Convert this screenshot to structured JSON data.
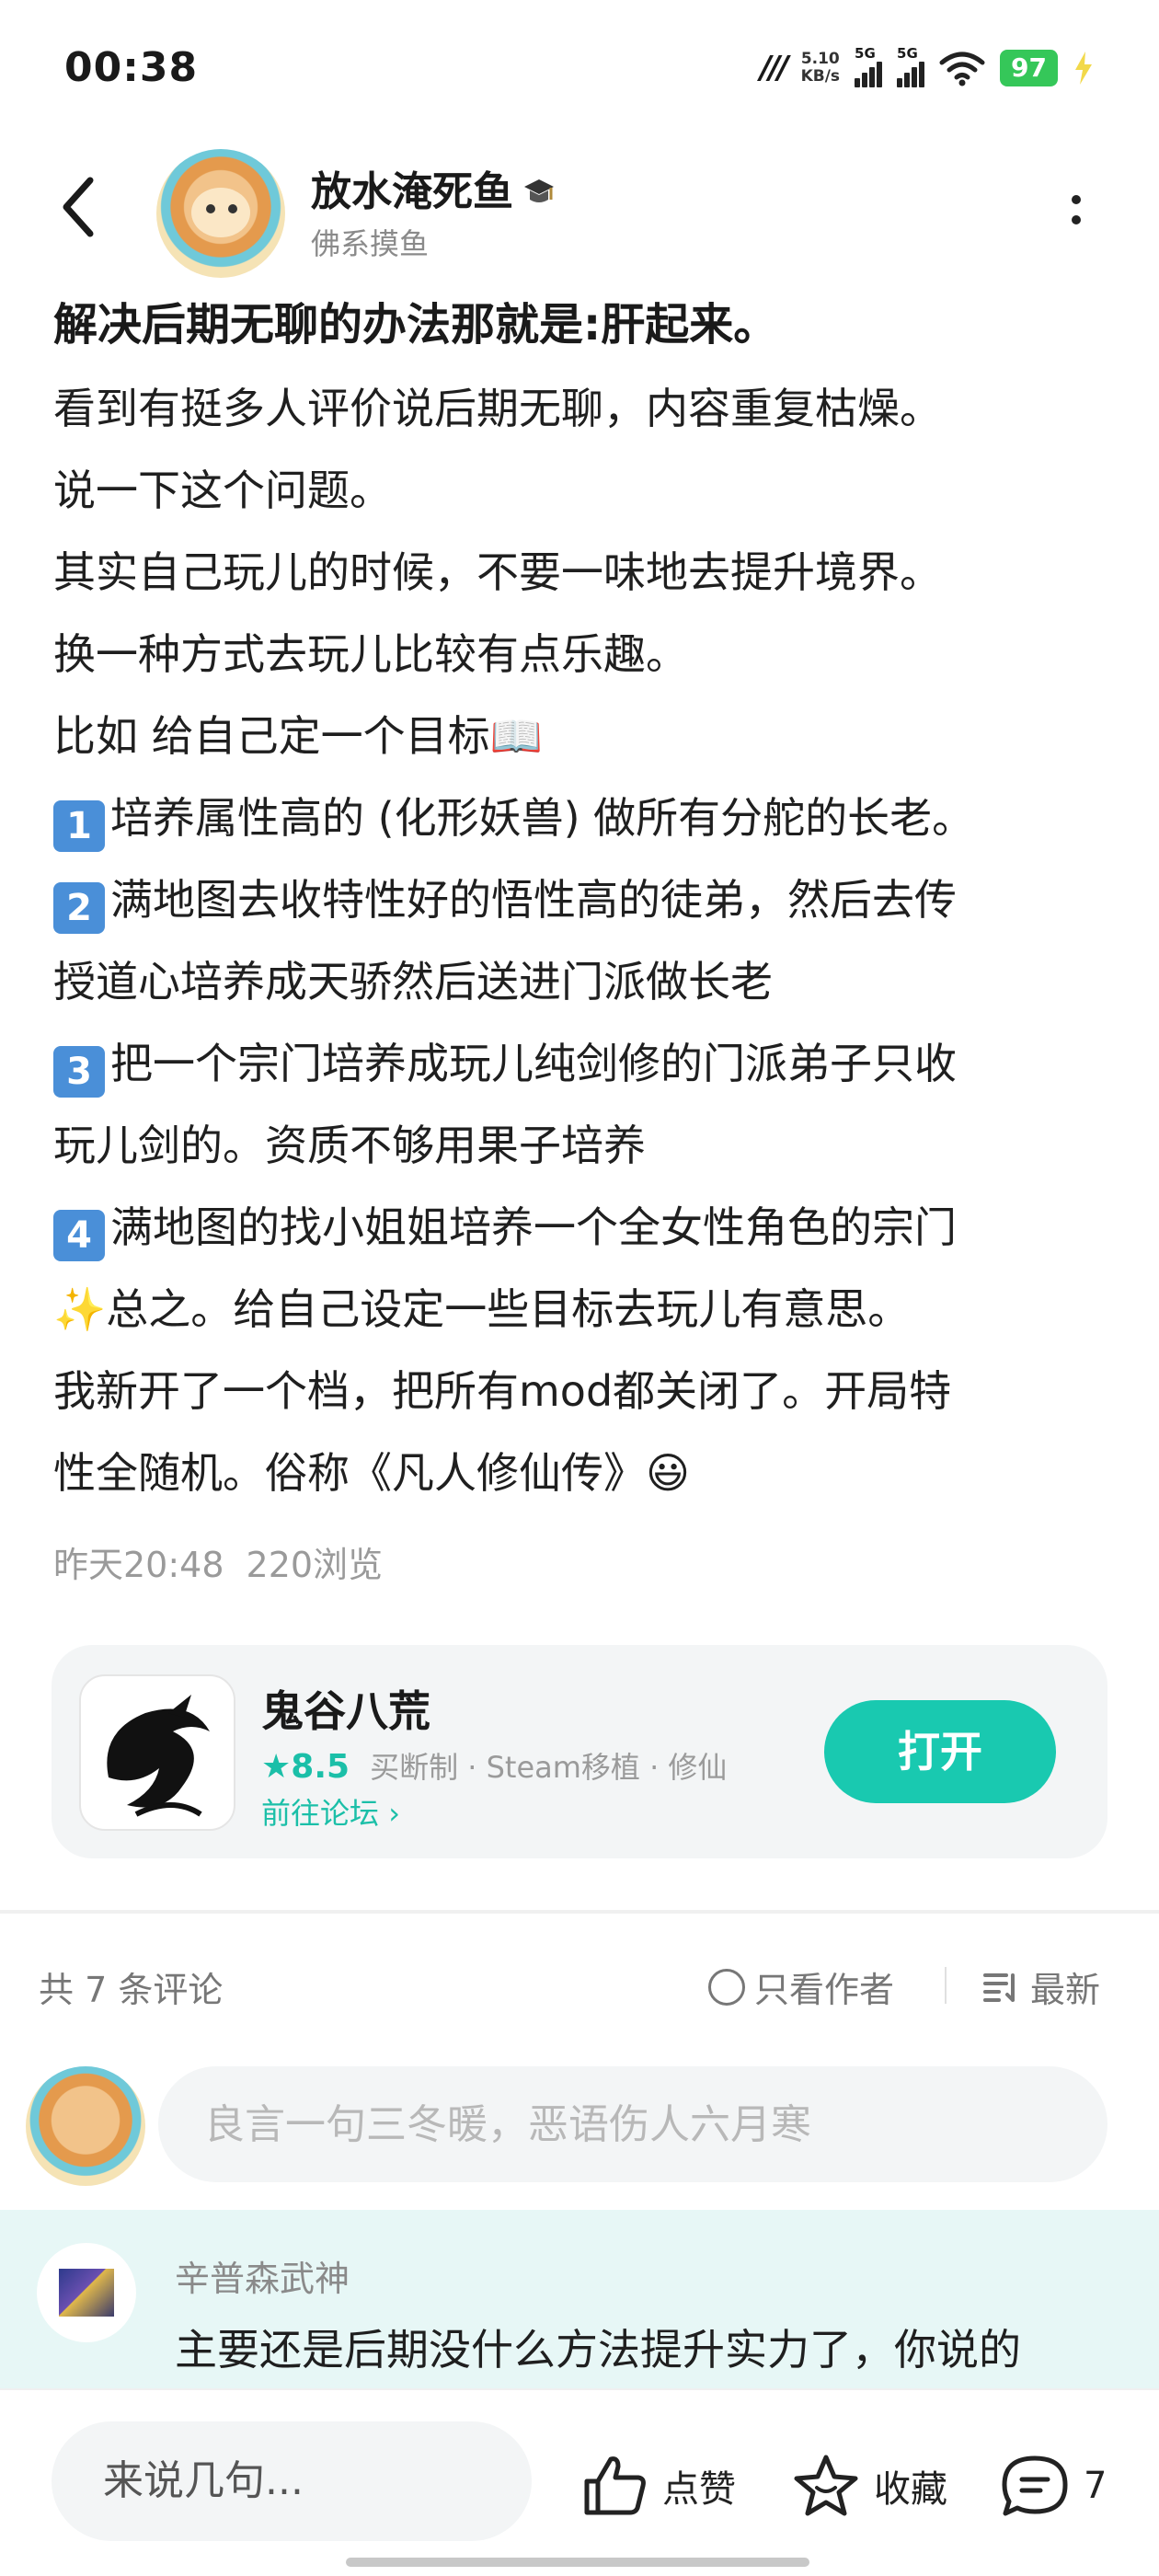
{
  "status_bar": {
    "time": "00:38",
    "net_speed_value": "5.10",
    "net_speed_unit": "KB/s",
    "sim1": "5G",
    "sim2": "5G",
    "battery": "97"
  },
  "author": {
    "name": "放水淹死鱼",
    "subtitle": "佛系摸鱼"
  },
  "post": {
    "title": "解决后期无聊的办法那就是:肝起来。",
    "lines": [
      "看到有挺多人评价说后期无聊，内容重复枯燥。",
      "说一下这个问题。",
      "其实自己玩儿的时候，不要一味地去提升境界。",
      "换一种方式去玩儿比较有点乐趣。",
      "比如 给自己定一个目标📖"
    ],
    "items": [
      {
        "num": "1",
        "text": "培养属性高的 (化形妖兽) 做所有分舵的长老。"
      },
      {
        "num": "2",
        "text": "满地图去收特性好的悟性高的徒弟，然后去传"
      },
      {
        "num": "",
        "text": "授道心培养成天骄然后送进门派做长老"
      },
      {
        "num": "3",
        "text": "把一个宗门培养成玩儿纯剑修的门派弟子只收"
      },
      {
        "num": "",
        "text": "玩儿剑的。资质不够用果子培养"
      },
      {
        "num": "4",
        "text": "满地图的找小姐姐培养一个全女性角色的宗门"
      }
    ],
    "tail_lines": [
      "✨总之。给自己设定一些目标去玩儿有意思。",
      "我新开了一个档，把所有mod都关闭了。开局特",
      "性全随机。俗称《凡人修仙传》😃"
    ],
    "time": "昨天20:48",
    "views": "220浏览"
  },
  "game": {
    "name": "鬼谷八荒",
    "score": "8.5",
    "tags": "买断制 · Steam移植 · 修仙",
    "forum_link": "前往论坛",
    "open_label": "打开"
  },
  "comments_header": {
    "count": "共 7 条评论",
    "only_author": "只看作者",
    "sort": "最新"
  },
  "comment_input": {
    "placeholder": "良言一句三冬暖，恶语伤人六月寒"
  },
  "comments": [
    {
      "name": "辛普森武神",
      "text": "主要还是后期没什么方法提升实力了，你说的"
    }
  ],
  "bottom_bar": {
    "input_placeholder": "来说几句...",
    "like_label": "点赞",
    "favorite_label": "收藏",
    "comment_count": "7"
  }
}
